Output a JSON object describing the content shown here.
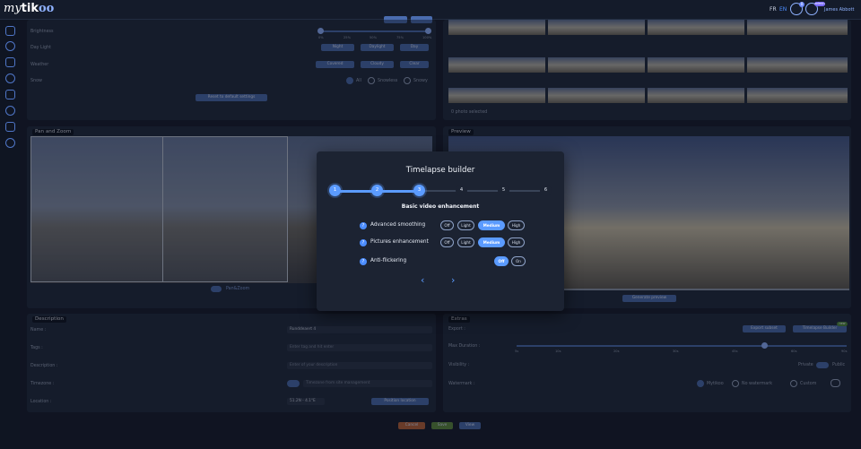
{
  "header": {
    "logo": {
      "my": "my",
      "tik": "tik",
      "oo": "oo"
    },
    "languages": [
      "FR",
      "EN"
    ],
    "notification_count": "0",
    "user_badge": "admin",
    "user_name": "James Abbott"
  },
  "settings_panel": {
    "brightness_label": "Brightness",
    "brightness_ticks": [
      "0%",
      "25%",
      "50%",
      "75%",
      "100%"
    ],
    "daylight_label": "Day Light",
    "daylight_options": [
      "Night",
      "Daylight",
      "Day"
    ],
    "weather_label": "Weather",
    "weather_options": [
      "Covered",
      "Cloudy",
      "Clear"
    ],
    "snow_label": "Snow",
    "snow_options": [
      "All",
      "Snowless",
      "Snowy"
    ],
    "reset_button": "Reset to default settings"
  },
  "photos_panel": {
    "selected_text": "0 photo selected"
  },
  "pan_zoom": {
    "title": "Pan and Zoom",
    "toggle_label": "Pan&Zoom"
  },
  "preview": {
    "title": "Preview",
    "generate_button": "Generate preview"
  },
  "description": {
    "title": "Description",
    "name_label": "Name :",
    "name_value": "Runddeaert 4",
    "tags_label": "Tags :",
    "tags_placeholder": "Enter tag and hit enter",
    "description_label": "Description :",
    "description_placeholder": "Enter of your description",
    "timezone_label": "Timezone :",
    "timezone_placeholder": "Timezone from site management",
    "location_label": "Location :",
    "location_value": "51.2N - 4.1°E",
    "position_button": "Position location"
  },
  "extras": {
    "title": "Extras",
    "export_label": "Export :",
    "export_button": "Export subset",
    "timelapse_button": "Timelapse Builder",
    "new_badge": "new",
    "max_duration_label": "Max Duration :",
    "duration_ticks": [
      "5s",
      "10s",
      "20s",
      "30s",
      "45s",
      "60s",
      "90s"
    ],
    "visibility_label": "Visibility :",
    "visibility_options": [
      "Private",
      "Public"
    ],
    "watermark_label": "Watermark :",
    "watermark_options": [
      "Mytikoo",
      "No watermark",
      "Custom"
    ]
  },
  "footer_buttons": [
    "Cancel",
    "Save",
    "View"
  ],
  "modal": {
    "title": "Timelapse builder",
    "steps": [
      "1",
      "2",
      "3",
      "4",
      "5",
      "6"
    ],
    "current_step": 3,
    "subtitle": "Basic video enhancement",
    "options": [
      {
        "label": "Advanced smoothing",
        "choices": [
          "Off",
          "Light",
          "Medium",
          "High"
        ],
        "selected": "Medium"
      },
      {
        "label": "Pictures enhancement",
        "choices": [
          "Off",
          "Light",
          "Medium",
          "High"
        ],
        "selected": "Medium"
      },
      {
        "label": "Anti-flickering",
        "choices": [
          "Off",
          "On"
        ],
        "selected": "Off"
      }
    ],
    "prev_icon": "chevron-left-icon",
    "next_icon": "chevron-right-icon",
    "accent_color": "#5b9bff"
  }
}
